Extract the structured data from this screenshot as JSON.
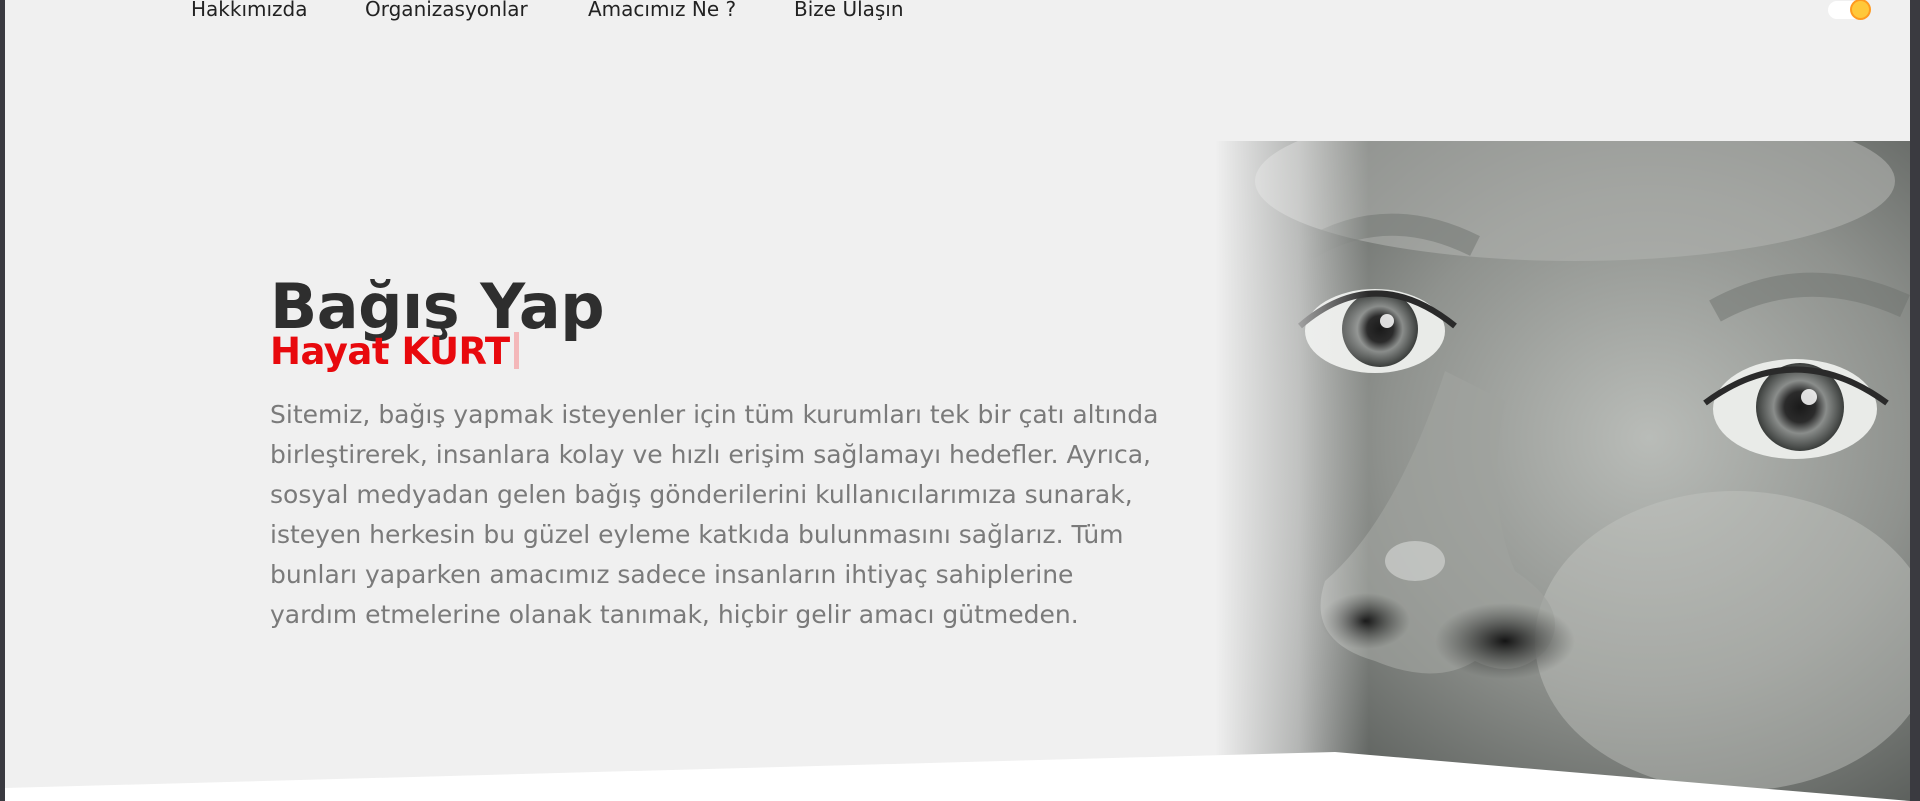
{
  "nav": {
    "items": [
      {
        "label": "Hakkımızda"
      },
      {
        "label": "Organizasyonlar"
      },
      {
        "label": "Amacımız Ne ?"
      },
      {
        "label": "Bize Ulaşın"
      }
    ],
    "theme_icon": "sun-icon"
  },
  "hero": {
    "title": "Bağış Yap",
    "subtitle": "Hayat KURT",
    "description_lines": [
      "Sitemiz, bağış yapmak isteyenler için tüm kurumları tek bir çatı altında",
      "birleştirerek, insanlara kolay ve hızlı erişim sağlamayı hedefler. Ayrıca,",
      "sosyal medyadan gelen bağış gönderilerini kullanıcılarımıza sunarak,",
      "isteyen herkesin bu güzel eyleme katkıda bulunmasını sağlarız. Tüm",
      "bunları yaparken amacımız sadece insanların ihtiyaç sahiplerine",
      "yardım etmelerine olanak tanımak, hiçbir gelir amacı gütmeden."
    ]
  },
  "colors": {
    "background": "#f0f0f0",
    "title": "#2e2e2e",
    "accent": "#e8090d",
    "body_text": "#7a7a7a",
    "toggle_sun": "#ffc83a"
  }
}
